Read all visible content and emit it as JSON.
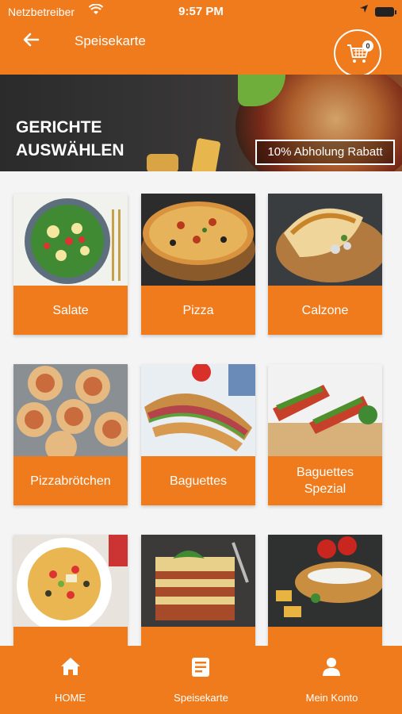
{
  "status_bar": {
    "carrier": "Netzbetreiber",
    "time": "9:57 PM"
  },
  "header": {
    "title": "Speisekarte",
    "cart_count": "0"
  },
  "banner": {
    "heading_line1": "GERICHTE",
    "heading_line2": "AUSWÄHLEN",
    "promo": "10% Abholung Rabatt"
  },
  "categories": [
    {
      "label": "Salate",
      "image": "salad-photo"
    },
    {
      "label": "Pizza",
      "image": "pizza-photo"
    },
    {
      "label": "Calzone",
      "image": "calzone-photo"
    },
    {
      "label": "Pizzabrötchen",
      "image": "pizza-rolls-photo"
    },
    {
      "label": "Baguettes",
      "image": "baguette-photo"
    },
    {
      "label": "Baguettes Spezial",
      "image": "baguette-special-photo"
    },
    {
      "label": "",
      "image": "pasta-photo"
    },
    {
      "label": "",
      "image": "lasagna-photo"
    },
    {
      "label": "",
      "image": "schnitzel-photo"
    }
  ],
  "bottom_nav": {
    "home": "HOME",
    "menu": "Speisekarte",
    "account": "Mein Konto"
  },
  "colors": {
    "accent": "#f07b1d",
    "background": "#f4f4f4"
  }
}
